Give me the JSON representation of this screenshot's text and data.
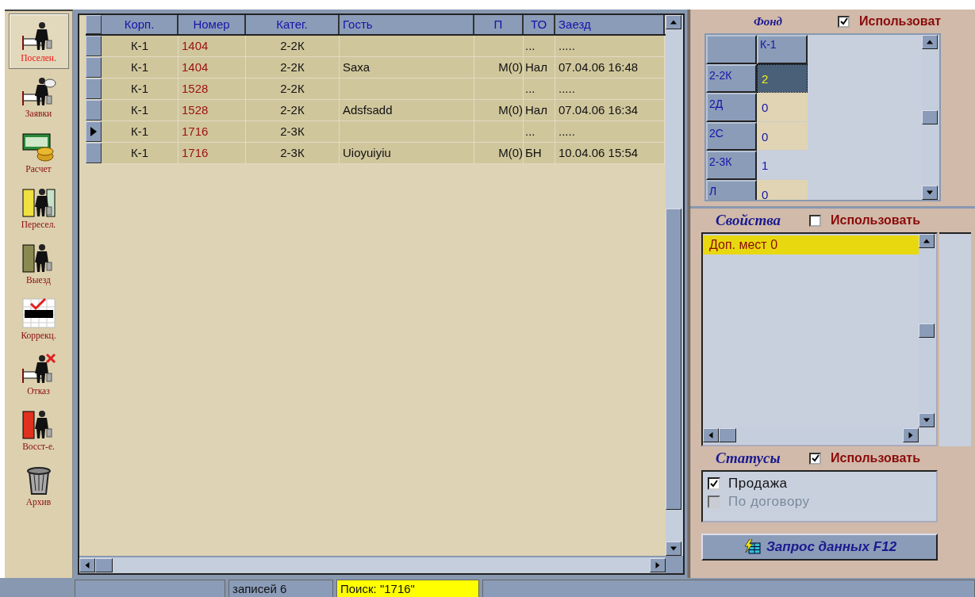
{
  "toolbar": [
    {
      "label": "Поселен.",
      "selected": true
    },
    {
      "label": "Заявки",
      "selected": false
    },
    {
      "label": "Расчет",
      "selected": false
    },
    {
      "label": "Пересел.",
      "selected": false
    },
    {
      "label": "Выезд",
      "selected": false
    },
    {
      "label": "Коррекц.",
      "selected": false
    },
    {
      "label": "Отказ",
      "selected": false
    },
    {
      "label": "Восст-е.",
      "selected": false
    },
    {
      "label": "Архив",
      "selected": false
    }
  ],
  "grid": {
    "columns": [
      "Корп.",
      "Номер",
      "Катег.",
      "Гость",
      "П",
      "ТО",
      "Заезд"
    ],
    "rows": [
      {
        "selected": false,
        "cells": [
          "К-1",
          "1404",
          "2-2К",
          "",
          "",
          "...",
          "....."
        ]
      },
      {
        "selected": false,
        "cells": [
          "К-1",
          "1404",
          "2-2К",
          "Saxa",
          "М(0)",
          "Нал",
          "07.04.06 16:48"
        ]
      },
      {
        "selected": false,
        "cells": [
          "К-1",
          "1528",
          "2-2К",
          "",
          "",
          "...",
          "....."
        ]
      },
      {
        "selected": false,
        "cells": [
          "К-1",
          "1528",
          "2-2К",
          "Adsfsadd",
          "М(0)",
          "Нал",
          "07.04.06 16:34"
        ]
      },
      {
        "selected": true,
        "cells": [
          "К-1",
          "1716",
          "2-3К",
          "",
          "",
          "...",
          "....."
        ]
      },
      {
        "selected": false,
        "cells": [
          "К-1",
          "1716",
          "2-3К",
          "Uioyuiyiu",
          "М(0)",
          "БН",
          "10.04.06 15:54"
        ]
      }
    ]
  },
  "fond": {
    "title": "Фонд",
    "use_label": "Использоват",
    "use_checked": true,
    "column": "К-1",
    "rows": [
      {
        "label": "2-2К",
        "value": "2",
        "selected": true,
        "highlighted": false
      },
      {
        "label": "2Д",
        "value": "0",
        "selected": false,
        "highlighted": false
      },
      {
        "label": "2С",
        "value": "0",
        "selected": false,
        "highlighted": false
      },
      {
        "label": "2-3К",
        "value": "1",
        "selected": false,
        "highlighted": true
      },
      {
        "label": "Л",
        "value": "0",
        "selected": false,
        "highlighted": false
      }
    ]
  },
  "properties": {
    "title": "Свойства",
    "use_label": "Использовать",
    "use_checked": false,
    "items": [
      {
        "label": "Доп. мест  0",
        "selected": true
      }
    ]
  },
  "statuses": {
    "title": "Статусы",
    "use_label": "Использовать",
    "use_checked": true,
    "items": [
      {
        "label": "Продажа",
        "checked": true,
        "disabled": false
      },
      {
        "label": "По договору",
        "checked": false,
        "disabled": true
      }
    ]
  },
  "query_button": "Запрос данных F12",
  "status_bar": [
    {
      "highlighted": false
    },
    {
      "text": "записей 6",
      "highlighted": false
    },
    {
      "text": "Поиск: \"1716\"",
      "highlighted": true
    },
    {
      "highlighted": false
    }
  ]
}
